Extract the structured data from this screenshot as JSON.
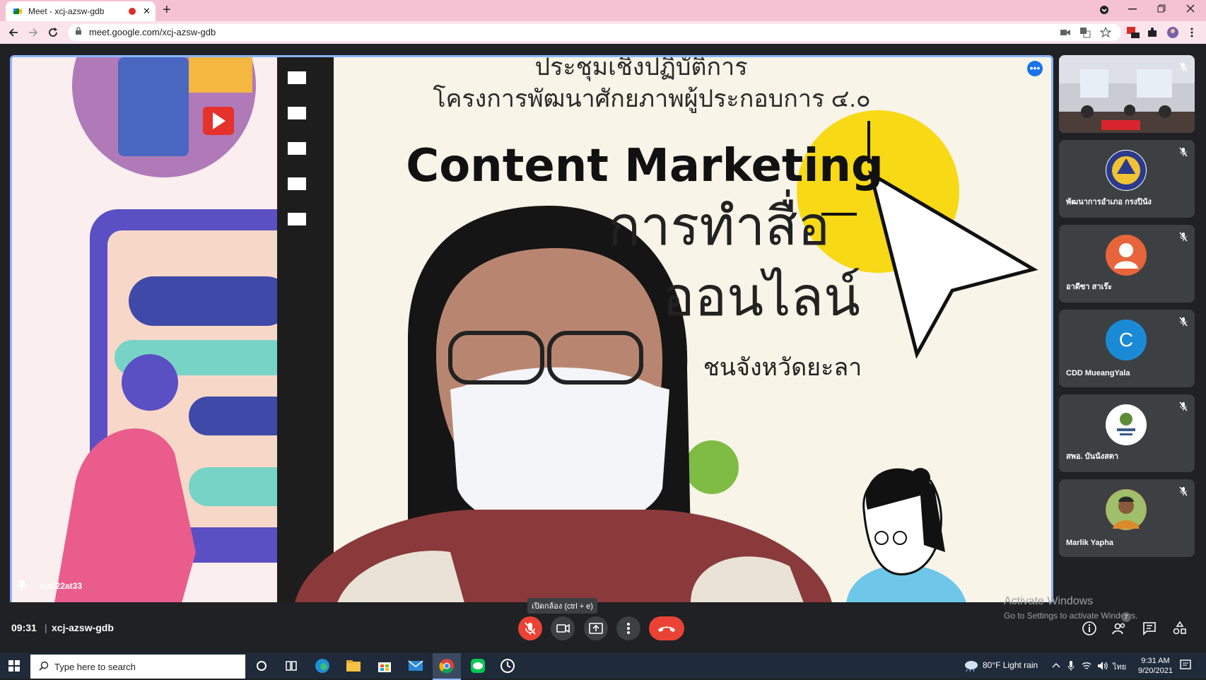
{
  "browser": {
    "tab_title": "Meet - xcj-azsw-gdb",
    "tab_close": "✕",
    "new_tab": "+",
    "url": "meet.google.com/xcj-azsw-gdb"
  },
  "stage": {
    "speaker_name": "nuri22at33",
    "slide": {
      "line1": "ประชุมเชิงปฏิบัติการ",
      "line2": "โครงการพัฒนาศักยภาพผู้ประกอบการ ๔.๐",
      "headline": "Content Marketing",
      "line4": "การทำสื่อ",
      "line5": "ออนไลน์",
      "line6": "ชนจังหวัดยะลา"
    }
  },
  "participants": [
    {
      "name": "",
      "kind": "video"
    },
    {
      "name": "พัฒนาการอำเภอ กรงปินัง",
      "kind": "logo",
      "color": "#2b3a8c"
    },
    {
      "name": "อาดีซา สาเร๊ะ",
      "kind": "default",
      "color": "#e8643a"
    },
    {
      "name": "CDD MueangYala",
      "kind": "letter",
      "letter": "C",
      "color": "#1b8ad6"
    },
    {
      "name": "สพอ. บันนังสตา",
      "kind": "logo",
      "color": "#ffffff"
    },
    {
      "name": "Marlik Yapha",
      "kind": "photo",
      "color": "#c79b5e"
    }
  ],
  "controls": {
    "clock": "09:31",
    "separator": "|",
    "meeting_code": "xcj-azsw-gdb",
    "tooltip": "เปิดกล้อง (ctrl + e)",
    "people_count": "7"
  },
  "watermark": {
    "title": "Activate Windows",
    "subtitle": "Go to Settings to activate Windows."
  },
  "taskbar": {
    "search_placeholder": "Type here to search",
    "weather": "80°F  Light rain",
    "language": "ไทย",
    "time": "9:31 AM",
    "date": "9/20/2021"
  }
}
